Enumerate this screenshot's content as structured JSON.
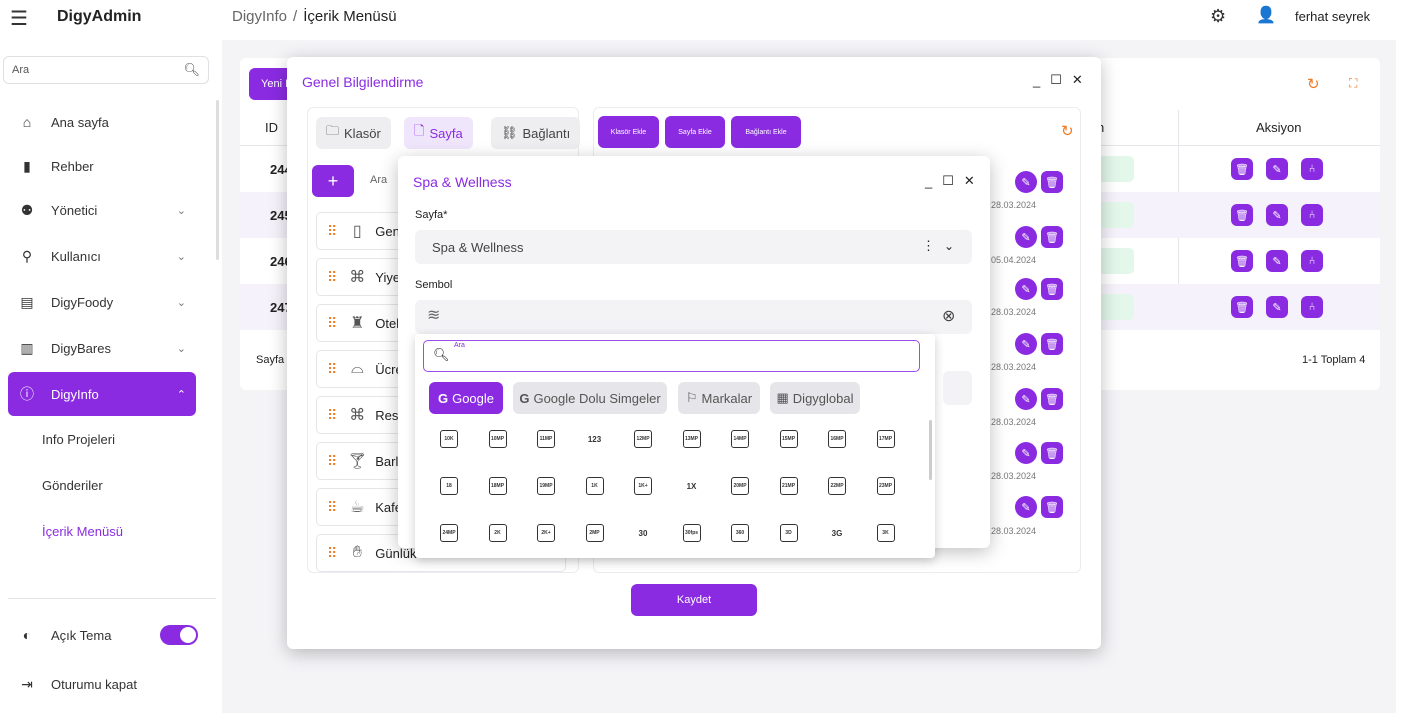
{
  "app": {
    "name": "DigyAdmin"
  },
  "header": {
    "breadcrumb_root": "DigyInfo",
    "breadcrumb_sep": "/",
    "breadcrumb_current": "İçerik Menüsü",
    "user_name": "ferhat seyrek"
  },
  "sidebar": {
    "search_placeholder": "Ara",
    "items": [
      {
        "label": "Ana sayfa"
      },
      {
        "label": "Rehber"
      },
      {
        "label": "Yönetici"
      },
      {
        "label": "Kullanıcı"
      },
      {
        "label": "DigyFoody"
      },
      {
        "label": "DigyBares"
      },
      {
        "label": "DigyInfo"
      }
    ],
    "sub_items": [
      {
        "label": "Info Projeleri"
      },
      {
        "label": "Gönderiler"
      },
      {
        "label": "İçerik Menüsü"
      }
    ],
    "theme_label": "Açık Tema",
    "logout_label": "Oturumu kapat"
  },
  "table": {
    "new_button": "Yeni E",
    "col_id": "ID",
    "col_n": "n",
    "col_actions": "Aksiyon",
    "rows": [
      {
        "id": "244"
      },
      {
        "id": "245"
      },
      {
        "id": "246"
      },
      {
        "id": "247"
      }
    ],
    "footer_left": "Sayfa b",
    "footer_right": "1-1 Toplam 4"
  },
  "dialog_outer": {
    "title": "Genel Bilgilendirme",
    "tabs": {
      "klasor": "Klasör",
      "sayfa": "Sayfa",
      "baglanti": "Bağlantı"
    },
    "search_placeholder": "Ara",
    "list": [
      {
        "label": "Gen"
      },
      {
        "label": "Yiye"
      },
      {
        "label": "Otel"
      },
      {
        "label": "Ücre"
      },
      {
        "label": "Rest"
      },
      {
        "label": "Barla"
      },
      {
        "label": "Kafe"
      },
      {
        "label": "Günlük"
      }
    ],
    "add_buttons": {
      "klasor": "Klasör Ekle",
      "sayfa": "Sayfa Ekle",
      "baglanti": "Bağlantı Ekle"
    },
    "dates": [
      "28.03.2024",
      "05.04.2024",
      "28.03.2024",
      "28.03.2024",
      "28.03.2024",
      "28.03.2024",
      "28.03.2024"
    ],
    "save_label": "Kaydet"
  },
  "dialog_inner": {
    "title": "Spa & Wellness",
    "sayfa_label": "Sayfa*",
    "sayfa_value": "Spa & Wellness",
    "sembol_label": "Sembol",
    "search_label": "Ara",
    "filters": {
      "google": "Google",
      "google_dolu": "Google Dolu Simgeler",
      "markalar": "Markalar",
      "digyglobal": "Digyglobal"
    },
    "icon_row1": [
      "10K",
      "10MP",
      "11MP",
      "123",
      "12MP",
      "13MP",
      "14MP",
      "15MP",
      "16MP",
      "17MP"
    ],
    "icon_row2": [
      "18",
      "18MP",
      "19MP",
      "1K",
      "1K+",
      "1X",
      "20MP",
      "21MP",
      "22MP",
      "23MP"
    ],
    "icon_row3": [
      "24MP",
      "2K",
      "2K+",
      "2MP",
      "30",
      "30fps",
      "360",
      "3D",
      "3G",
      "3K"
    ]
  },
  "colors": {
    "accent": "#8a2be2",
    "accent_light": "#a855f7",
    "orange": "#f07a22",
    "bg": "#f4f4f7"
  }
}
